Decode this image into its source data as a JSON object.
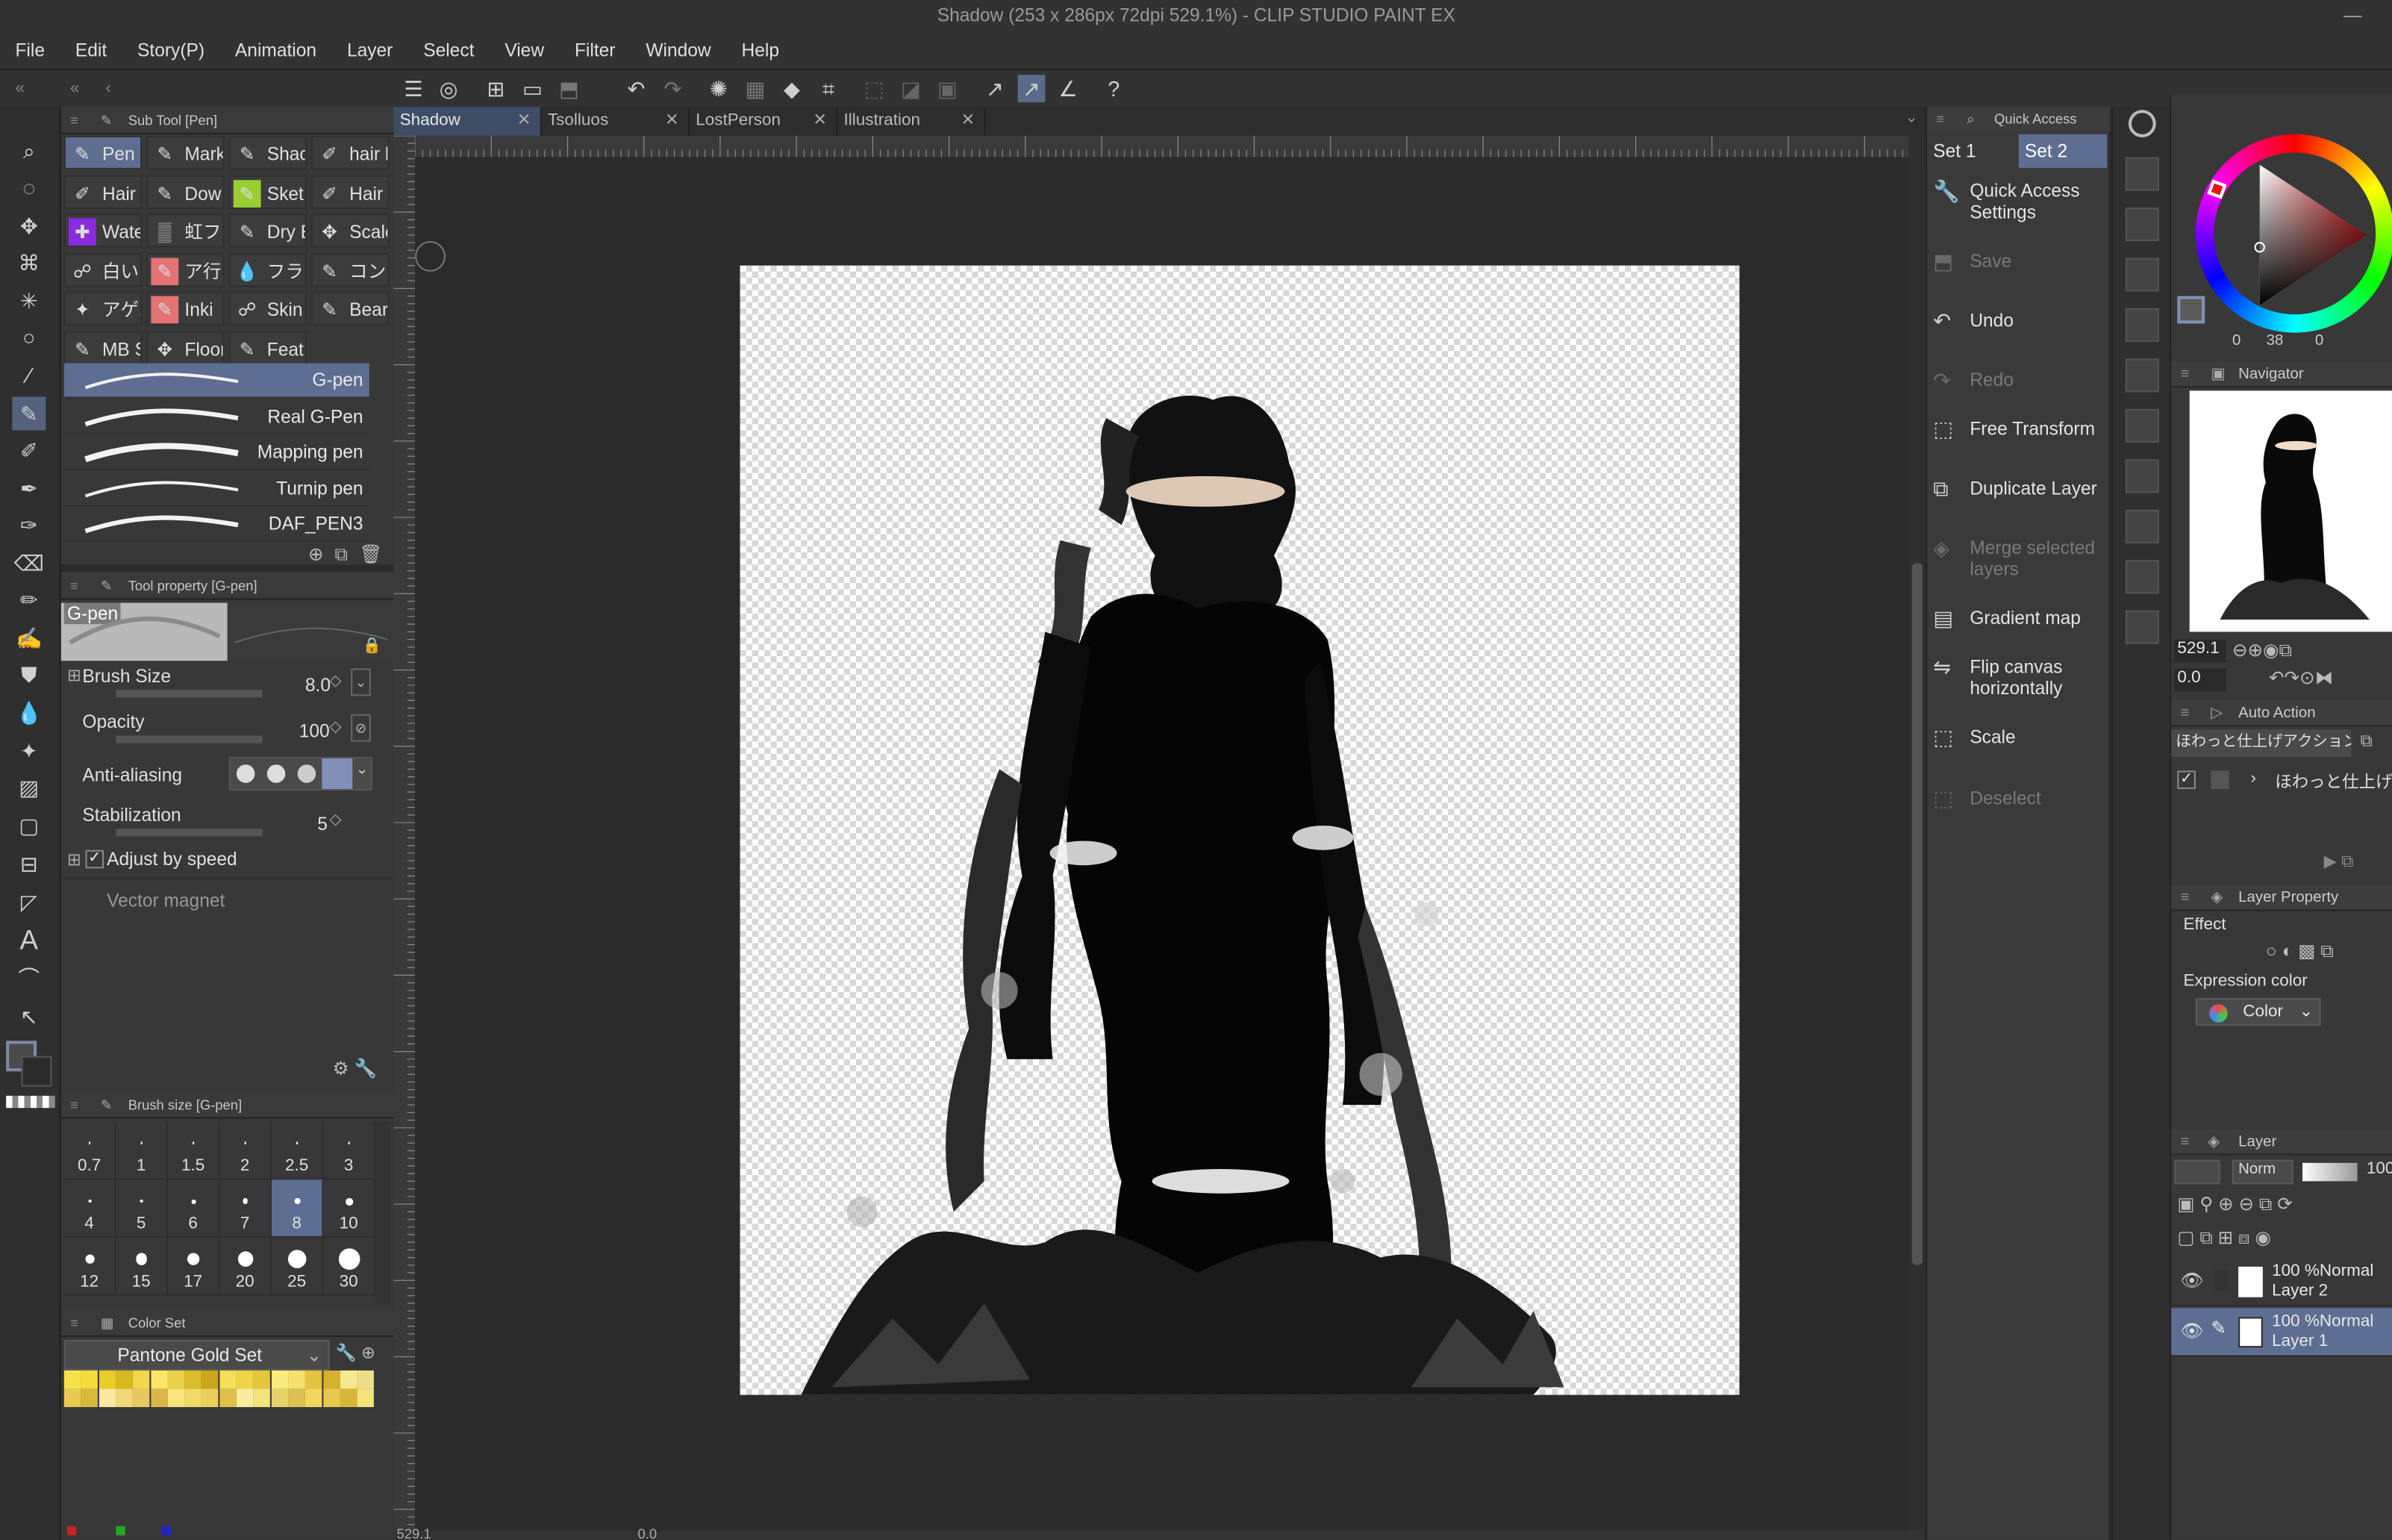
{
  "window": {
    "title": "Shadow (253 x 286px 72dpi 529.1%)  - CLIP STUDIO PAINT EX"
  },
  "menu": [
    "File",
    "Edit",
    "Story(P)",
    "Animation",
    "Layer",
    "Select",
    "View",
    "Filter",
    "Window",
    "Help"
  ],
  "doc_tabs": [
    {
      "label": "Shadow",
      "active": true
    },
    {
      "label": "Tsolluos",
      "active": false
    },
    {
      "label": "LostPerson",
      "active": false
    },
    {
      "label": "Illustration",
      "active": false
    }
  ],
  "subtool": {
    "header": "Sub Tool [Pen]",
    "groups": [
      "Pen",
      "Mark",
      "Shac",
      "hair l",
      "Hair",
      "Dow",
      "Sket",
      "Hair",
      "Wate",
      "虹フラ",
      "Dry E",
      "Scale",
      "白いゴ",
      "ア行ゃ",
      "フラッ",
      "コンク",
      "アゲハ",
      "Inki",
      "Skin",
      "Bear",
      "MB S",
      "Floor",
      "Feat"
    ],
    "brushes": [
      "G-pen",
      "Real G-Pen",
      "Mapping pen",
      "Turnip pen",
      "DAF_PEN3"
    ]
  },
  "tool_property": {
    "header": "Tool property [G-pen]",
    "preview_name": "G-pen",
    "brush_size_label": "Brush Size",
    "brush_size_value": "8.0",
    "opacity_label": "Opacity",
    "opacity_value": "100",
    "antialias_label": "Anti-aliasing",
    "stabilization_label": "Stabilization",
    "stabilization_value": "5",
    "adjust_speed_label": "Adjust by speed",
    "vector_magnet_label": "Vector magnet"
  },
  "brush_sizes": {
    "header": "Brush size [G-pen]",
    "values": [
      "0.7",
      "1",
      "1.5",
      "2",
      "2.5",
      "3",
      "4",
      "5",
      "6",
      "7",
      "8",
      "10",
      "12",
      "15",
      "17",
      "20",
      "25",
      "30"
    ],
    "selected": "8"
  },
  "color_set": {
    "header": "Color Set",
    "set_name": "Pantone Gold Set",
    "swatches": [
      "#f6e24a",
      "#f3dc3b",
      "#e8cc2c",
      "#d8b81f",
      "#f1d74a",
      "#f7e66a",
      "#ead24c",
      "#d9bd2a",
      "#c9a61a",
      "#f4de5a",
      "#efd546",
      "#e4c83b",
      "#f9ea7c",
      "#f7e16e",
      "#e3c341",
      "#d6b12d",
      "#f5e892",
      "#eedc88",
      "#e9cb52",
      "#d9b83c",
      "#fae8a0",
      "#f1d876",
      "#e7c962",
      "#ddb64a",
      "#f8e37c",
      "#f2da67",
      "#ebcf5b",
      "#dfc04b",
      "#f9ee9f",
      "#f4e27e",
      "#e8d36a",
      "#ddbf52",
      "#f0d65e",
      "#e7ca4c",
      "#d8b63c",
      "#f3e37a"
    ]
  },
  "quick_access": {
    "header": "Quick Access",
    "set1": "Set 1",
    "set2": "Set 2",
    "items": [
      {
        "label": "Quick Access Settings",
        "enabled": true,
        "icon": "wrench-icon"
      },
      {
        "label": "Save",
        "enabled": false,
        "icon": "save-icon"
      },
      {
        "label": "Undo",
        "enabled": true,
        "icon": "undo-icon"
      },
      {
        "label": "Redo",
        "enabled": false,
        "icon": "redo-icon"
      },
      {
        "label": "Free Transform",
        "enabled": true,
        "icon": "transform-icon"
      },
      {
        "label": "Duplicate Layer",
        "enabled": true,
        "icon": "duplicate-icon"
      },
      {
        "label": "Merge selected layers",
        "enabled": false,
        "icon": "merge-icon"
      },
      {
        "label": "Gradient map",
        "enabled": true,
        "icon": "gradient-icon"
      },
      {
        "label": "Flip canvas horizontally",
        "enabled": true,
        "icon": "flip-icon"
      },
      {
        "label": "Scale",
        "enabled": true,
        "icon": "scale-icon"
      },
      {
        "label": "Deselect",
        "enabled": false,
        "icon": "deselect-icon"
      }
    ]
  },
  "color_wheel": {
    "h_val": "0",
    "s_val": "0",
    "v_val": "38"
  },
  "navigator": {
    "header": "Navigator",
    "zoom": "529.1",
    "rotation": "0.0"
  },
  "auto_action": {
    "header": "Auto Action",
    "set": "ほわっと仕上げアクション",
    "item": "ほわっと仕上げ"
  },
  "layer_property": {
    "header": "Layer Property",
    "effect_label": "Effect",
    "expression_label": "Expression color",
    "expression_value": "Color"
  },
  "layers": {
    "header": "Layer",
    "blend_mode": "Norm",
    "opacity": "100",
    "items": [
      {
        "top": "100 %Normal",
        "name": "Layer 2",
        "selected": false
      },
      {
        "top": "100 %Normal",
        "name": "Layer 1",
        "selected": true
      }
    ]
  },
  "status": {
    "zoom": "529.1",
    "angle": "0.0"
  }
}
